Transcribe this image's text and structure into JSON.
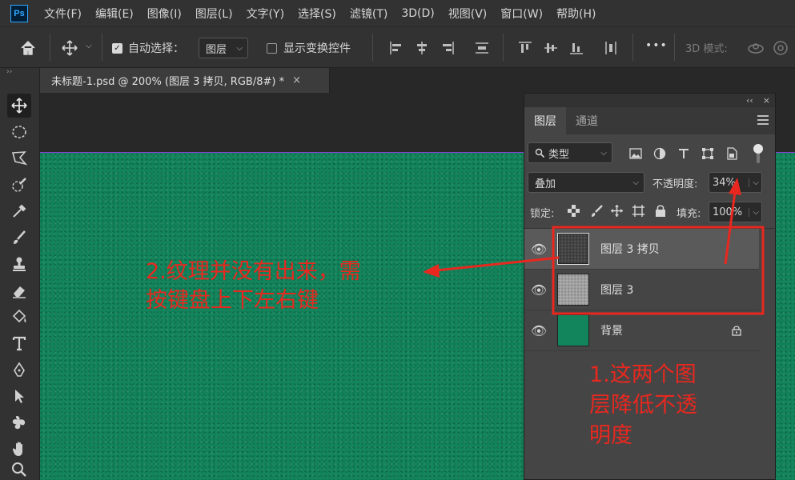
{
  "app": {
    "logo": "Ps"
  },
  "menu": [
    "文件(F)",
    "编辑(E)",
    "图像(I)",
    "图层(L)",
    "文字(Y)",
    "选择(S)",
    "滤镜(T)",
    "3D(D)",
    "视图(V)",
    "窗口(W)",
    "帮助(H)"
  ],
  "options": {
    "auto_select_label": "自动选择：",
    "auto_select_checked": true,
    "auto_select_target": "图层",
    "show_transform_label": "显示变换控件",
    "show_transform_checked": false,
    "more_label": "•••",
    "mode_3d_label": "3D 模式:"
  },
  "document": {
    "tab_title": "未标题-1.psd @ 200% (图层 3 拷贝, RGB/8#) *",
    "close": "×"
  },
  "toolbar": {
    "tools": [
      "move-tool-icon",
      "elliptical-marquee-icon",
      "polygonal-lasso-icon",
      "quick-selection-icon",
      "eyedropper-icon",
      "brush-icon",
      "clone-stamp-icon",
      "eraser-icon",
      "paint-bucket-icon",
      "type-tool-icon",
      "pen-tool-icon",
      "path-selection-icon",
      "custom-shape-icon",
      "hand-tool-icon",
      "zoom-tool-icon"
    ],
    "active": "move-tool-icon"
  },
  "canvas": {
    "color": "#13855c"
  },
  "layers_panel": {
    "collapse": "‹‹",
    "close": "×",
    "tabs": [
      "图层",
      "通道"
    ],
    "active_tab": "图层",
    "filter_kind": "类型",
    "blend_mode": "叠加",
    "opacity_label": "不透明度:",
    "opacity_value": "34%",
    "lock_label": "锁定:",
    "fill_label": "填充:",
    "fill_value": "100%",
    "layers": [
      {
        "name": "图层 3 拷贝",
        "selected": true,
        "visible": true,
        "thumb": "dark-noise",
        "locked": false
      },
      {
        "name": "图层 3",
        "selected": false,
        "visible": true,
        "thumb": "light-noise",
        "locked": false
      },
      {
        "name": "背景",
        "selected": false,
        "visible": true,
        "thumb": "green",
        "locked": true
      }
    ]
  },
  "annotations": {
    "note_texture_line1": "2.纹理并没有出来，需",
    "note_texture_line2": "按键盘上下左右键",
    "note_opacity_line1": "1.这两个图",
    "note_opacity_line2": "层降低不透",
    "note_opacity_line3": "明度",
    "color": "#e8281f"
  }
}
